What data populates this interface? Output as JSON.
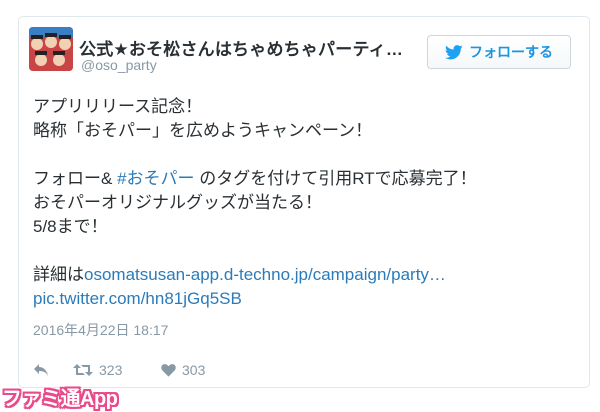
{
  "tweet": {
    "display_name": "公式★おそ松さんはちゃめちゃパーティ…",
    "handle": "@oso_party",
    "follow_label": "フォローする",
    "lines": {
      "l1": "アプリリリース記念！",
      "l2": "略称「おそパー」を広めようキャンペーン！",
      "l3_prefix": "フォロー& ",
      "l3_hashtag": "#おそパー",
      "l3_suffix": " のタグを付けて引用RTで応募完了！",
      "l4": "おそパーオリジナルグッズが当たる！",
      "l5": "5/8まで！",
      "l6_prefix": "詳細は",
      "l6_link": "osomatsusan-app.d-techno.jp/campaign/party…",
      "l7_link": "pic.twitter.com/hn81jGq5SB"
    },
    "timestamp": "2016年4月22日 18:17",
    "retweet_count": "323",
    "like_count": "303"
  },
  "watermark": {
    "text": "ファミ通App"
  },
  "colors": {
    "link": "#2b7bb9",
    "follow_text": "#1b95e0",
    "muted": "#8899a6",
    "text": "#292f33",
    "watermark": "#e94b8a"
  },
  "icons": {
    "follow": "twitter-bird-icon",
    "reply": "reply-icon",
    "retweet": "retweet-icon",
    "like": "heart-icon"
  }
}
